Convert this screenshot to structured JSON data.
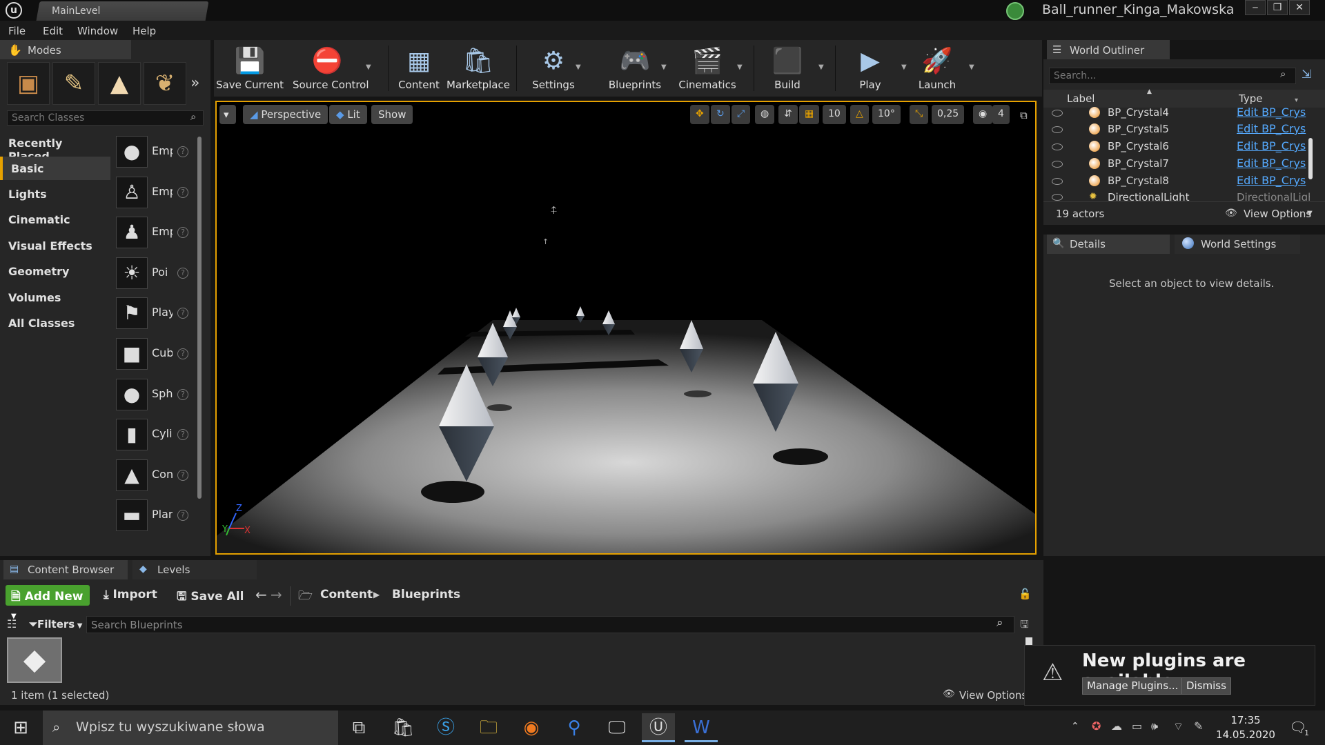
{
  "app": {
    "doc_tab": "MainLevel",
    "project": "Ball_runner_Kinga_Makowska",
    "menu": [
      "File",
      "Edit",
      "Window",
      "Help"
    ]
  },
  "modes": {
    "title": "Modes",
    "search_placeholder": "Search Classes",
    "categories": [
      "Recently Placed",
      "Basic",
      "Lights",
      "Cinematic",
      "Visual Effects",
      "Geometry",
      "Volumes",
      "All Classes"
    ],
    "classes": [
      {
        "name": "Emp",
        "icon": "sphere-icon"
      },
      {
        "name": "Emp",
        "icon": "character-icon"
      },
      {
        "name": "Emp",
        "icon": "pawn-icon"
      },
      {
        "name": "Poi",
        "icon": "lightbulb-icon"
      },
      {
        "name": "Play",
        "icon": "player-start-icon"
      },
      {
        "name": "Cub",
        "icon": "cube-icon"
      },
      {
        "name": "Sph",
        "icon": "sphere-icon"
      },
      {
        "name": "Cyli",
        "icon": "cylinder-icon"
      },
      {
        "name": "Con",
        "icon": "cone-icon"
      },
      {
        "name": "Plar",
        "icon": "plane-icon"
      }
    ]
  },
  "toolbar": {
    "buttons": [
      {
        "label": "Save Current",
        "icon": "save-icon"
      },
      {
        "label": "Source Control",
        "icon": "source-control-icon"
      },
      {
        "label": "Content",
        "icon": "content-icon"
      },
      {
        "label": "Marketplace",
        "icon": "marketplace-icon"
      },
      {
        "label": "Settings",
        "icon": "settings-icon"
      },
      {
        "label": "Blueprints",
        "icon": "blueprints-icon"
      },
      {
        "label": "Cinematics",
        "icon": "cinematics-icon"
      },
      {
        "label": "Build",
        "icon": "build-icon"
      },
      {
        "label": "Play",
        "icon": "play-icon"
      },
      {
        "label": "Launch",
        "icon": "launch-icon"
      }
    ]
  },
  "viewport": {
    "perspective": "Perspective",
    "lit": "Lit",
    "show": "Show",
    "grid_snap": "10",
    "rotation_snap": "10°",
    "scale_snap": "0,25",
    "camera_speed": "4",
    "axis_x": "X",
    "axis_y": "Y",
    "axis_z": "Z"
  },
  "outliner": {
    "title": "World Outliner",
    "search_placeholder": "Search...",
    "col_label": "Label",
    "col_type": "Type",
    "rows": [
      {
        "label": "BP_Crystal4",
        "type": "Edit BP_Crys"
      },
      {
        "label": "BP_Crystal5",
        "type": "Edit BP_Crys"
      },
      {
        "label": "BP_Crystal6",
        "type": "Edit BP_Crys"
      },
      {
        "label": "BP_Crystal7",
        "type": "Edit BP_Crys"
      },
      {
        "label": "BP_Crystal8",
        "type": "Edit BP_Crys"
      },
      {
        "label": "DirectionalLight",
        "type": "DirectionalLight"
      }
    ],
    "actors": "19 actors",
    "view_options": "View Options"
  },
  "details": {
    "tab": "Details",
    "world_settings_tab": "World Settings",
    "hint": "Select an object to view details."
  },
  "content_browser": {
    "tab": "Content Browser",
    "levels_tab": "Levels",
    "add_new": "Add New",
    "import": "Import",
    "save_all": "Save All",
    "path": [
      "Content",
      "Blueprints"
    ],
    "filters": "Filters",
    "search_placeholder": "Search Blueprints",
    "status": "1 item (1 selected)",
    "view_options": "View Options"
  },
  "notification": {
    "text": "New plugins are available",
    "manage": "Manage Plugins...",
    "dismiss": "Dismiss"
  },
  "taskbar": {
    "search": "Wpisz tu wyszukiwane słowa",
    "time": "17:35",
    "date": "14.05.2020",
    "notif_count": "1"
  }
}
